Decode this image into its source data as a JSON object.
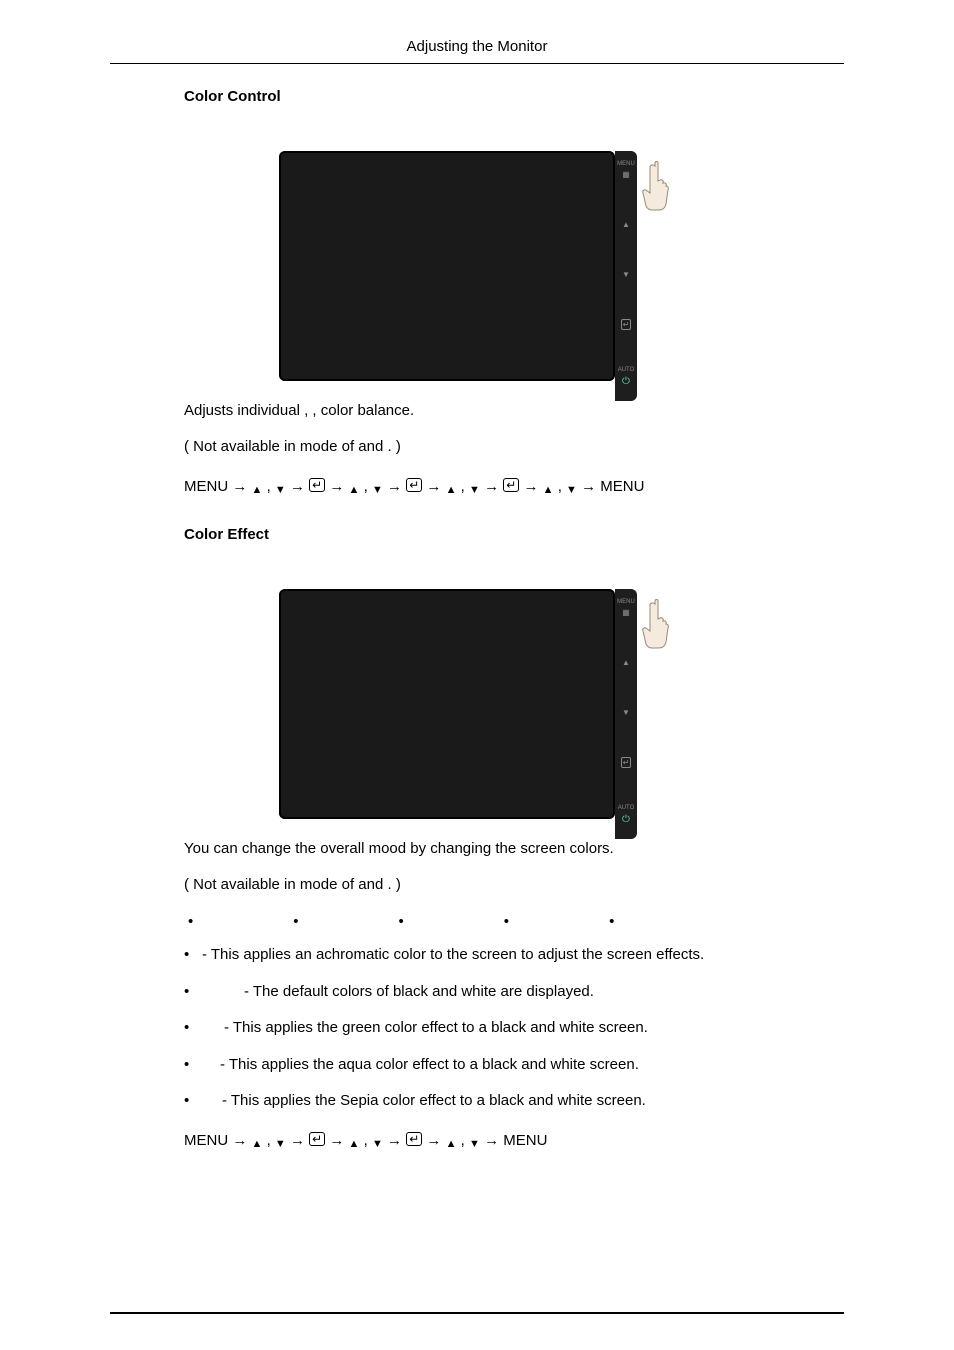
{
  "header": {
    "title": "Adjusting the Monitor"
  },
  "section1": {
    "title": "Color Control",
    "line1_a": "Adjusts individual ",
    "line1_b": ", ",
    "line1_c": ", ",
    "line1_d": " color balance.",
    "line2_a": "( Not available in ",
    "line2_b": " mode of ",
    "line2_c": " and ",
    "line2_d": ". )",
    "seq_prefix": "MENU → ",
    "seq_mid": " → ",
    "seq_comma": " , ",
    "seq_suffix": " → MENU"
  },
  "section2": {
    "title": "Color Effect",
    "intro": "You can change the overall mood by changing the screen colors.",
    "line2_a": "( Not available in ",
    "line2_b": " mode of ",
    "line2_c": " and ",
    "line2_d": ". )",
    "dots": [
      "",
      "",
      "",
      "",
      ""
    ],
    "bullets": [
      " - This applies an achromatic color to the screen to adjust the screen effects.",
      " - The default colors of black and white are displayed.",
      " - This applies the green color effect to a black and white screen.",
      " - This applies the aqua color effect to a black and white screen.",
      " - This applies the Sepia color effect to a black and white screen."
    ],
    "seq_prefix": "MENU → ",
    "seq_mid": " → ",
    "seq_comma": " , ",
    "seq_suffix": " → MENU"
  },
  "side_labels": {
    "menu": "MENU",
    "auto": "AUTO"
  }
}
